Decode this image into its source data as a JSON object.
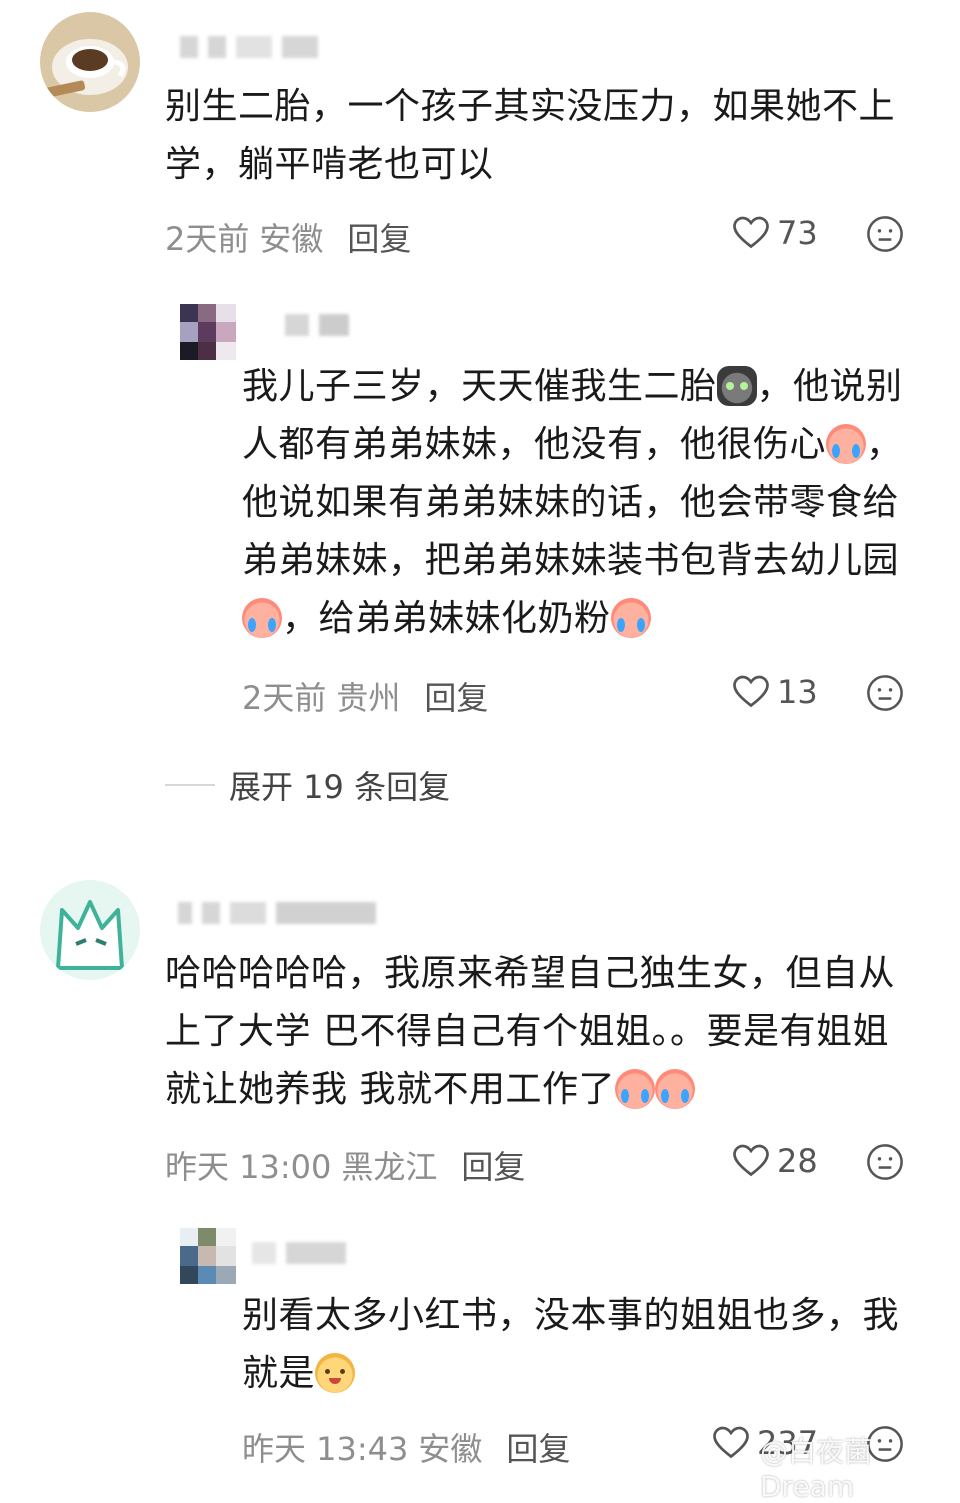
{
  "comments": [
    {
      "text": "别生二胎，一个孩子其实没压力，如果她不上学，躺平啃老也可以",
      "time": "2天前",
      "location": "安徽",
      "reply_label": "回复",
      "likes": "73",
      "avatar": "coffee-cup-avatar",
      "replies": [
        {
          "text_parts": [
            "我儿子三岁，天天催我生二胎",
            "，他说别人都有弟弟妹妹，他没有，他很伤心",
            "，他说如果有弟弟妹妹的话，他会带零食给弟弟妹妹，把弟弟妹妹装书包背去幼儿园",
            "，给弟弟妹妹化奶粉"
          ],
          "time": "2天前",
          "location": "贵州",
          "reply_label": "回复",
          "likes": "13",
          "avatar": "pixel-avatar"
        }
      ],
      "expand_label": "展开 19 条回复"
    },
    {
      "text_parts": [
        "哈哈哈哈哈，我原来希望自己独生女，但自从上了大学 巴不得自己有个姐姐。。要是有姐姐就让她养我 我就不用工作了"
      ],
      "time": "昨天 13:00",
      "location": "黑龙江",
      "reply_label": "回复",
      "likes": "28",
      "avatar": "cartoon-cat-avatar",
      "replies": [
        {
          "text_parts": [
            "别看太多小红书，没本事的姐姐也多，我就是"
          ],
          "time": "昨天 13:43",
          "location": "安徽",
          "reply_label": "回复",
          "likes": "237",
          "avatar": "pixel-avatar"
        }
      ]
    }
  ],
  "watermark": "@白夜菌Dream",
  "icons": {
    "like": "heart-outline-icon",
    "dislike": "neutral-face-icon"
  },
  "colors": {
    "text": "#1a1a1a",
    "meta": "#8e8e8e",
    "reply": "#555555"
  }
}
